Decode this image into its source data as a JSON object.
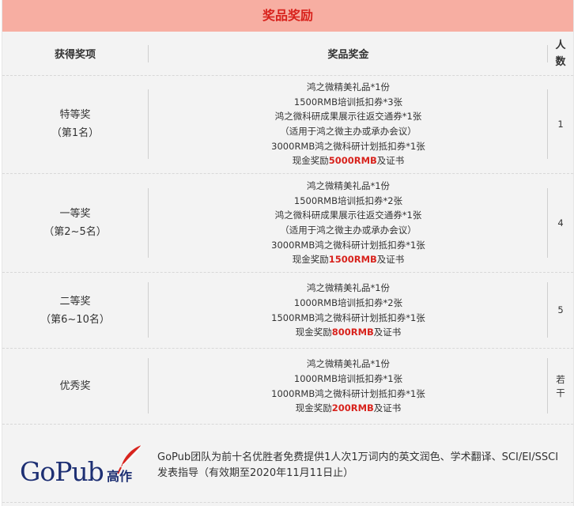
{
  "title": "奖品奖励",
  "headers": {
    "award": "获得奖项",
    "prize": "奖品奖金",
    "count_line1": "人",
    "count_line2": "数"
  },
  "rows": [
    {
      "name": "特等奖",
      "rank": "（第1名）",
      "lines": [
        "鸿之微精美礼品*1份",
        "1500RMB培训抵扣券*3张",
        "鸿之微科研成果展示往返交通券*1张",
        "（适用于鸿之微主办或承办会议）",
        "3000RMB鸿之微科研计划抵扣券*1张"
      ],
      "cash_prefix": "现金奖励",
      "cash_amount": "5000RMB",
      "cash_suffix": "及证书",
      "count_line1": "1",
      "count_line2": ""
    },
    {
      "name": "一等奖",
      "rank": "（第2~5名）",
      "lines": [
        "鸿之微精美礼品*1份",
        "1500RMB培训抵扣券*2张",
        "鸿之微科研成果展示往返交通券*1张",
        "（适用于鸿之微主办或承办会议）",
        "3000RMB鸿之微科研计划抵扣券*1张"
      ],
      "cash_prefix": "现金奖励",
      "cash_amount": "1500RMB",
      "cash_suffix": "及证书",
      "count_line1": "4",
      "count_line2": ""
    },
    {
      "name": "二等奖",
      "rank": "（第6~10名）",
      "lines": [
        "鸿之微精美礼品*1份",
        "1000RMB培训抵扣券*2张",
        "1500RMB鸿之微科研计划抵扣券*1张"
      ],
      "cash_prefix": "现金奖励",
      "cash_amount": "800RMB",
      "cash_suffix": "及证书",
      "count_line1": "5",
      "count_line2": ""
    },
    {
      "name": "优秀奖",
      "rank": "",
      "lines": [
        "鸿之微精美礼品*1份",
        "1000RMB培训抵扣券*1张",
        "1000RMB鸿之微科研计划抵扣券*1张"
      ],
      "cash_prefix": "现金奖励",
      "cash_amount": "200RMB",
      "cash_suffix": "及证书",
      "count_line1": "若",
      "count_line2": "干"
    }
  ],
  "footer": {
    "logo_text": "GoPub",
    "logo_cn": "高作",
    "text": "GoPub团队为前十名优胜者免费提供1人次1万词内的英文润色、学术翻译、SCI/EI/SSCI发表指导（有效期至2020年11月11日止）"
  },
  "colors": {
    "title_bg": "#f7aea2",
    "accent_red": "#d8231d",
    "logo_blue": "#1d2f73"
  }
}
